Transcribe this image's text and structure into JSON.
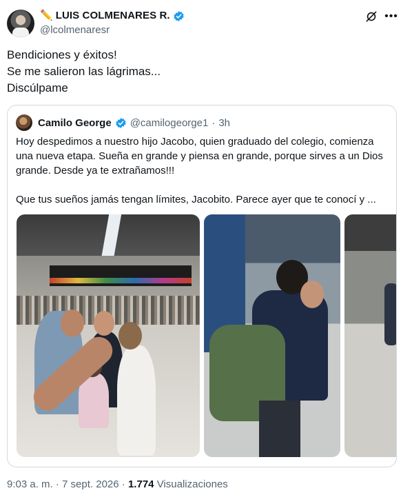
{
  "author": {
    "display_name": "LUIS COLMENARES R.",
    "handle": "@lcolmenaresr",
    "name_emoji": "✏️"
  },
  "post": {
    "lines": [
      "Bendiciones y éxitos!",
      "Se me salieron las lágrimas...",
      "Discúlpame"
    ]
  },
  "quote": {
    "name": "Camilo George",
    "handle": "@camilogeorge1",
    "dot": "·",
    "time": "3h",
    "paragraph1": "Hoy despedimos a nuestro hijo Jacobo, quien graduado del colegio, comienza una nueva etapa. Sueña en grande y piensa en grande, porque sirves a un Dios grande. Desde ya te extrañamos!!!",
    "paragraph2": "Que tus sueños jamás tengan límites, Jacobito.  Parece ayer que te conocí y ..."
  },
  "footer": {
    "time": "9:03 a. m.",
    "sep1": "·",
    "date": "7 sept. 2026",
    "sep2": "·",
    "views_count": "1.774",
    "views_label": "Visualizaciones"
  },
  "colors": {
    "verified": "#1d9bf0",
    "secondary_text": "#536471",
    "border": "#cfd9de"
  }
}
